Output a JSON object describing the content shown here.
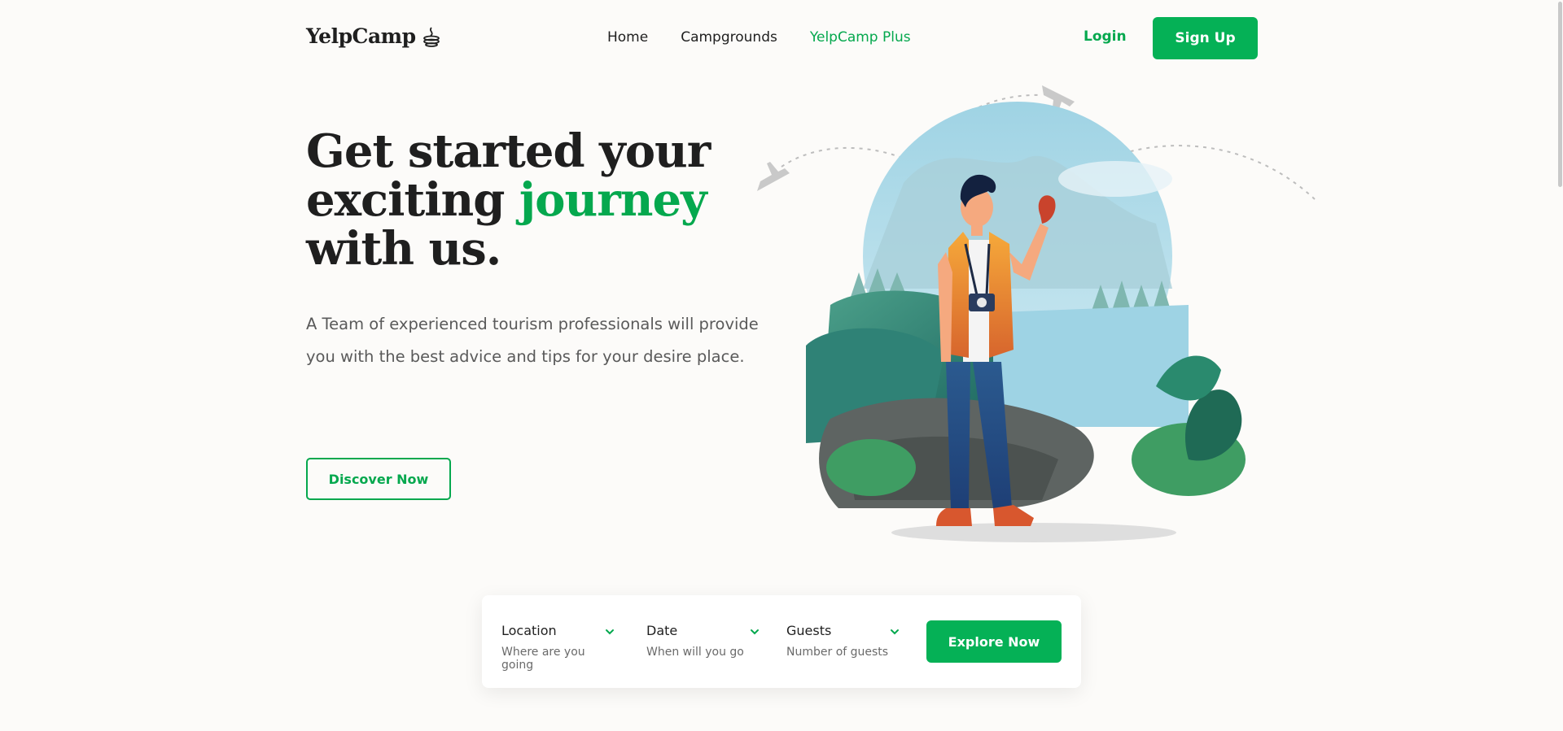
{
  "brand": {
    "name": "YelpCamp",
    "icon": "campfire-icon",
    "accent": "#05a84e"
  },
  "nav": {
    "items": [
      {
        "label": "Home"
      },
      {
        "label": "Campgrounds"
      },
      {
        "label": "YelpCamp Plus"
      }
    ]
  },
  "auth": {
    "login": "Login",
    "signup": "Sign Up"
  },
  "hero": {
    "title_line1": "Get started your",
    "title_line2_a": "exciting ",
    "title_line2_b": "journey",
    "title_line3": "with us.",
    "description": "A Team of experienced tourism professionals will provide you with the best advice and tips for your desire place.",
    "cta": "Discover Now"
  },
  "search": {
    "fields": [
      {
        "label": "Location",
        "placeholder": "Where are you going",
        "icon": "chevron-down-icon"
      },
      {
        "label": "Date",
        "placeholder": "When will you go",
        "icon": "chevron-down-icon"
      },
      {
        "label": "Guests",
        "placeholder": "Number of guests",
        "icon": "chevron-down-icon"
      }
    ],
    "button": "Explore Now"
  }
}
